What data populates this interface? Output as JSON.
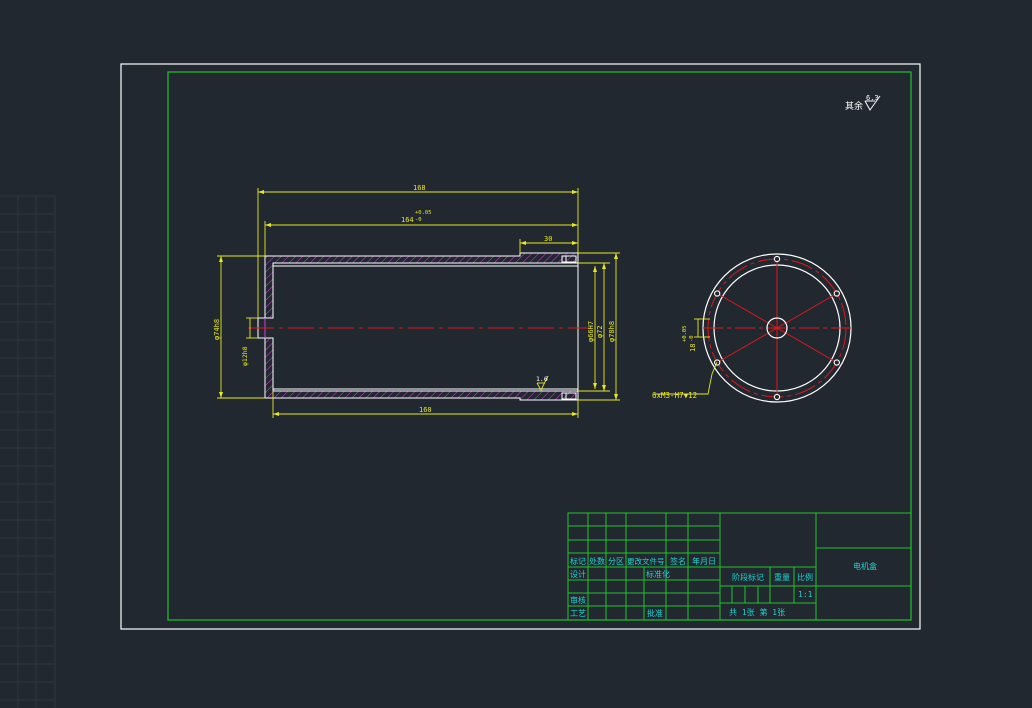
{
  "colors": {
    "background": "#212830",
    "sheet_border": "#ffffff",
    "frame": "#22c22a",
    "dimension": "#e8e820",
    "part_outline": "#ffffff",
    "hatch": "#d040d8",
    "centerline": "#e01818",
    "table_text": "#20d0d0",
    "grid": "#2e3640"
  },
  "drawing": {
    "roughness_note": "其余",
    "roughness_value": "6.3",
    "section_view": {
      "dim_overall_length": "168",
      "dim_inner_length": "164",
      "dim_inner_length_tol_upper": "+0.05",
      "dim_inner_length_tol_lower": "-0",
      "dim_step_length": "30",
      "dim_bottom_length": "160",
      "dim_outer_diameter": "φ74h8",
      "dim_boss_diameter": "φ12h8",
      "dim_bore_diameter": "φ66H7",
      "dim_mid_diameter": "φ72",
      "dim_flange_diameter": "φ78h8",
      "roughness_inner": "1.6"
    },
    "end_view": {
      "dim_slot": "18",
      "dim_slot_tol_upper": "+0.05",
      "dim_slot_tol_lower": "-0",
      "hole_note": "6xM3-H7▼12"
    }
  },
  "title_block": {
    "header_labels": [
      "标记",
      "处数",
      "分区",
      "更改文件号",
      "签名",
      "年月日"
    ],
    "row_design": "设计",
    "row_standardize": "标准化",
    "row_review": "审核",
    "row_process": "工艺",
    "row_approve": "批准",
    "stage_mark": "阶段标记",
    "weight": "重量",
    "scale_label": "比例",
    "scale_value": "1:1",
    "sheets": "共 1张 第 1张",
    "part_name": "电机盒"
  }
}
